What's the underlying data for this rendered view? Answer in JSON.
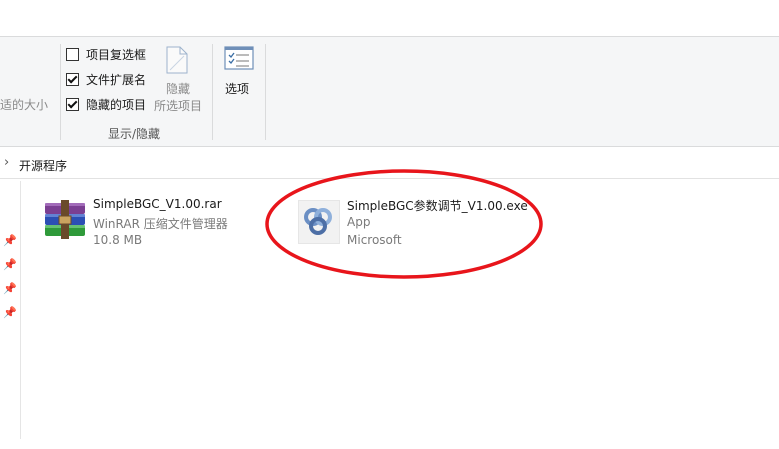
{
  "ribbon": {
    "fit_columns_label": "适的大小",
    "checkboxes": [
      {
        "label": "项目复选框",
        "checked": false
      },
      {
        "label": "文件扩展名",
        "checked": true
      },
      {
        "label": "隐藏的项目",
        "checked": true
      }
    ],
    "hide_selected": {
      "line1": "隐藏",
      "line2": "所选项目"
    },
    "group_label": "显示/隐藏",
    "options_label": "选项"
  },
  "address": {
    "chevron": "›",
    "path": "开源程序"
  },
  "files": [
    {
      "name": "SimpleBGC_V1.00.rar",
      "type": "WinRAR 压缩文件管理器",
      "size": "10.8 MB",
      "icon": "winrar-archive-icon"
    },
    {
      "name": "SimpleBGC参数调节_V1.00.exe",
      "type": "App",
      "publisher": "Microsoft",
      "icon": "app-rings-icon"
    }
  ],
  "colors": {
    "ribbon_bg": "#f5f6f7",
    "highlight_ellipse": "#e8151b",
    "app_icon": "#6b8fc4"
  }
}
